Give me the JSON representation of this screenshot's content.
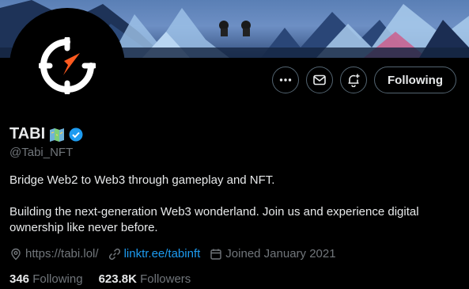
{
  "profile": {
    "name": "TABI",
    "handle": "@Tabi_NFT",
    "bio_line1": "Bridge Web2 to Web3 through gameplay and NFT.",
    "bio_line2": "Building the next-generation Web3 wonderland. Join us and experience digital ownership like never before.",
    "website": "https://tabi.lol/",
    "link": "linktr.ee/tabinft",
    "joined": "Joined January 2021",
    "following_count": "346",
    "following_label": "Following",
    "followers_count": "623.8K",
    "followers_label": "Followers"
  },
  "actions": {
    "more_icon": "more-horizontal-icon",
    "message_icon": "envelope-icon",
    "notify_icon": "bell-plus-icon",
    "follow_label": "Following"
  },
  "colors": {
    "accent": "#1d9bf0",
    "brand": "#ff5a1f",
    "muted": "#71767b"
  }
}
